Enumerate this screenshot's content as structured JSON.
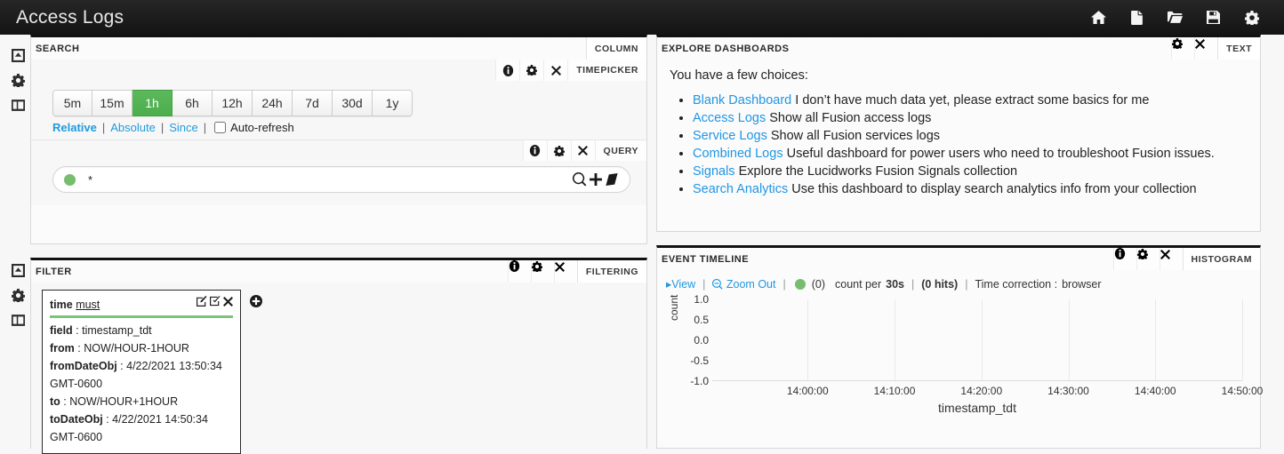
{
  "topbar": {
    "title": "Access Logs",
    "icons": [
      {
        "name": "home-icon"
      },
      {
        "name": "new-document-icon"
      },
      {
        "name": "open-folder-icon"
      },
      {
        "name": "save-icon"
      },
      {
        "name": "settings-gear-icon"
      }
    ]
  },
  "rail": {
    "icons": [
      {
        "name": "collapse-panel-icon"
      },
      {
        "name": "gear-icon"
      },
      {
        "name": "add-panel-icon"
      }
    ]
  },
  "search_panel": {
    "title": "SEARCH",
    "tab_label": "COLUMN",
    "timepicker": {
      "row_label": "TIMEPICKER",
      "icons": [
        "info-icon",
        "gear-icon",
        "close-icon"
      ],
      "ranges": [
        "5m",
        "15m",
        "1h",
        "6h",
        "12h",
        "24h",
        "7d",
        "30d",
        "1y"
      ],
      "active_range": "1h",
      "links": [
        "Relative",
        "Absolute",
        "Since"
      ],
      "autorefresh_label": "Auto-refresh",
      "autorefresh_checked": false
    },
    "query": {
      "row_label": "QUERY",
      "icons": [
        "info-icon",
        "gear-icon",
        "close-icon"
      ],
      "value": "*",
      "placeholder": "*",
      "dot_color": "#76bd6e",
      "action_icons": [
        "search-icon",
        "add-query-icon",
        "clear-query-icon"
      ]
    }
  },
  "filter_panel": {
    "title": "FILTER",
    "tab_label": "FILTERING",
    "icons": [
      "info-icon",
      "gear-icon",
      "close-icon"
    ],
    "card": {
      "name": "time",
      "type": "must",
      "accent_color": "#7cc47c",
      "icons": [
        "edit-icon",
        "toggle-filter-icon",
        "remove-filter-icon"
      ],
      "rows": [
        {
          "key": "field",
          "value": "timestamp_tdt"
        },
        {
          "key": "from",
          "value": "NOW/HOUR-1HOUR"
        },
        {
          "key": "fromDateObj",
          "value": "4/22/2021 13:50:34 GMT-0600"
        },
        {
          "key": "to",
          "value": "NOW/HOUR+1HOUR"
        },
        {
          "key": "toDateObj",
          "value": "4/22/2021 14:50:34 GMT-0600"
        }
      ]
    },
    "add_icon": "add-filter-icon"
  },
  "explore_panel": {
    "title": "EXPLORE DASHBOARDS",
    "tab_label": "TEXT",
    "icons": [
      "gear-icon",
      "close-icon"
    ],
    "intro": "You have a few choices:",
    "items": [
      {
        "link": "Blank Dashboard",
        "desc": "I don’t have much data yet, please extract some basics for me"
      },
      {
        "link": "Access Logs",
        "desc": "Show all Fusion access logs"
      },
      {
        "link": "Service Logs",
        "desc": "Show all Fusion services logs"
      },
      {
        "link": "Combined Logs",
        "desc": "Useful dashboard for power users who need to troubleshoot Fusion issues."
      },
      {
        "link": "Signals",
        "desc": "Explore the Lucidworks Fusion Signals collection"
      },
      {
        "link": "Search Analytics",
        "desc": "Use this dashboard to display search analytics info from your collection"
      }
    ]
  },
  "timeline_panel": {
    "title": "EVENT TIMELINE",
    "tab_label": "HISTOGRAM",
    "icons": [
      "info-icon",
      "gear-icon",
      "close-icon"
    ],
    "controls": {
      "view_label": "View",
      "zoom_out_label": "Zoom Out",
      "dot_color": "#76bd6e",
      "series_count": "(0)",
      "count_per_prefix": "count per",
      "count_per_value": "30s",
      "hits": "(0 hits)",
      "time_correction_label": "Time correction :",
      "time_correction_value": "browser"
    }
  },
  "chart_data": {
    "type": "bar",
    "title": "EVENT TIMELINE",
    "xlabel": "timestamp_tdt",
    "ylabel": "count",
    "x_ticks": [
      "14:00:00",
      "14:10:00",
      "14:20:00",
      "14:30:00",
      "14:40:00",
      "14:50:00"
    ],
    "y_ticks": [
      "1.0",
      "0.5",
      "0.0",
      "-0.5",
      "-1.0"
    ],
    "ylim": [
      -1.0,
      1.0
    ],
    "categories": [],
    "values": [],
    "series": [
      {
        "name": "count",
        "values": []
      }
    ],
    "grid": true,
    "legend": false,
    "hits": 0,
    "interval": "30s"
  }
}
